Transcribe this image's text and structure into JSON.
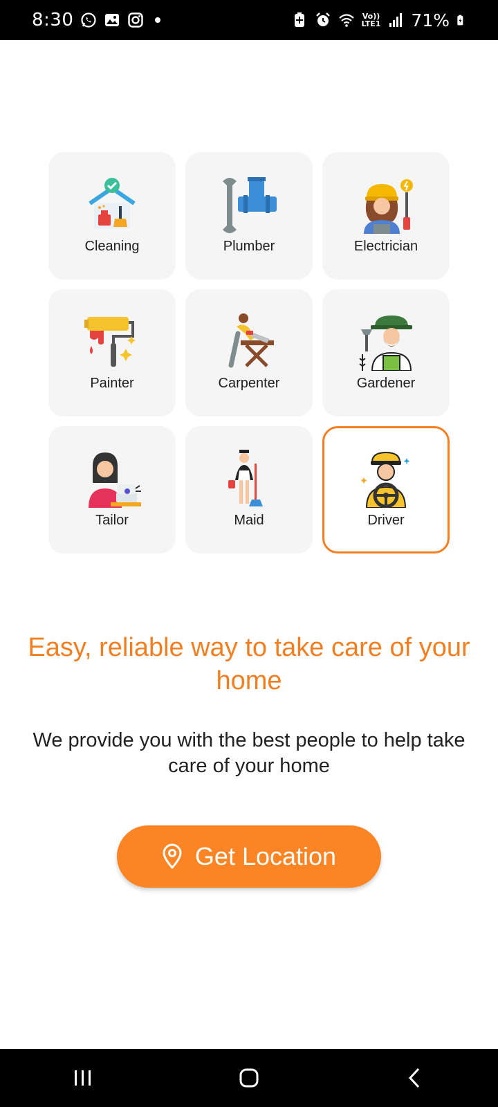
{
  "status_bar": {
    "time": "8:30",
    "battery": "71%",
    "network": "LTE1",
    "volte": "Vo))"
  },
  "services": [
    {
      "label": "Cleaning",
      "icon": "cleaning-icon",
      "selected": false
    },
    {
      "label": "Plumber",
      "icon": "plumber-icon",
      "selected": false
    },
    {
      "label": "Electrician",
      "icon": "electrician-icon",
      "selected": false
    },
    {
      "label": "Painter",
      "icon": "painter-icon",
      "selected": false
    },
    {
      "label": "Carpenter",
      "icon": "carpenter-icon",
      "selected": false
    },
    {
      "label": "Gardener",
      "icon": "gardener-icon",
      "selected": false
    },
    {
      "label": "Tailor",
      "icon": "tailor-icon",
      "selected": false
    },
    {
      "label": "Maid",
      "icon": "maid-icon",
      "selected": false
    },
    {
      "label": "Driver",
      "icon": "driver-icon",
      "selected": true
    }
  ],
  "headline": "Easy, reliable way to take care of your home",
  "subline": "We provide you with the best people to help take care of your home",
  "cta": {
    "label": "Get Location",
    "icon": "location-pin-icon"
  },
  "colors": {
    "accent": "#fb8424",
    "headline": "#f17f21",
    "tile_bg": "#f5f5f5",
    "selected_border": "#f57f21"
  }
}
